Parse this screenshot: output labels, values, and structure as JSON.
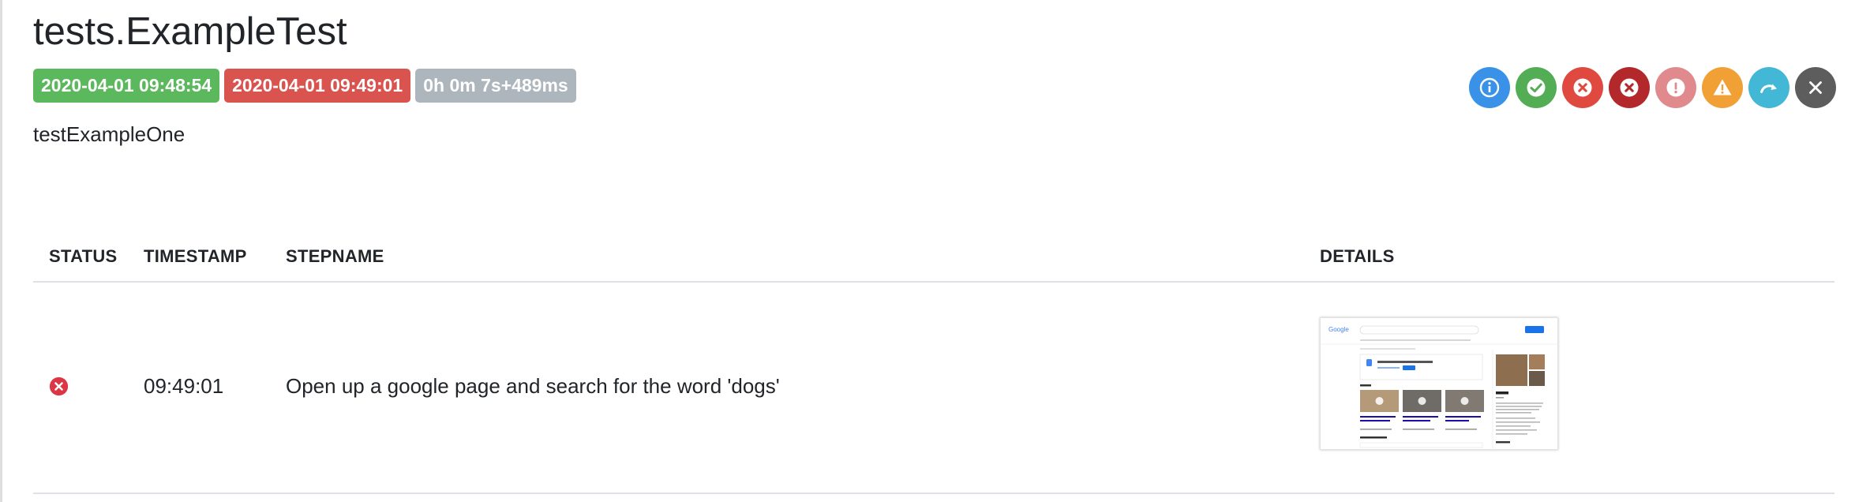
{
  "header": {
    "title": "tests.ExampleTest",
    "badges": {
      "start_time": "2020-04-01 09:48:54",
      "end_time": "2020-04-01 09:49:01",
      "duration": "0h 0m 7s+489ms"
    },
    "test_name": "testExampleOne"
  },
  "filters": [
    {
      "icon": "info-icon",
      "color": "#3a92e8"
    },
    {
      "icon": "check-icon",
      "color": "#53ad55"
    },
    {
      "icon": "x-circle-icon",
      "color": "#e0493f"
    },
    {
      "icon": "x-circle-icon",
      "color": "#b3282a"
    },
    {
      "icon": "exclamation-icon",
      "color": "#e08a8d"
    },
    {
      "icon": "warning-icon",
      "color": "#f0a035"
    },
    {
      "icon": "skip-icon",
      "color": "#43b7d6"
    },
    {
      "icon": "close-icon",
      "color": "#5d5d5d"
    }
  ],
  "table": {
    "columns": [
      "STATUS",
      "TIMESTAMP",
      "STEPNAME",
      "DETAILS"
    ],
    "rows": [
      {
        "status": "fail",
        "status_color": "#dc3545",
        "timestamp": "09:49:01",
        "stepname": "Open up a google page and search for the word 'dogs'",
        "details": "screenshot-thumbnail"
      }
    ]
  }
}
